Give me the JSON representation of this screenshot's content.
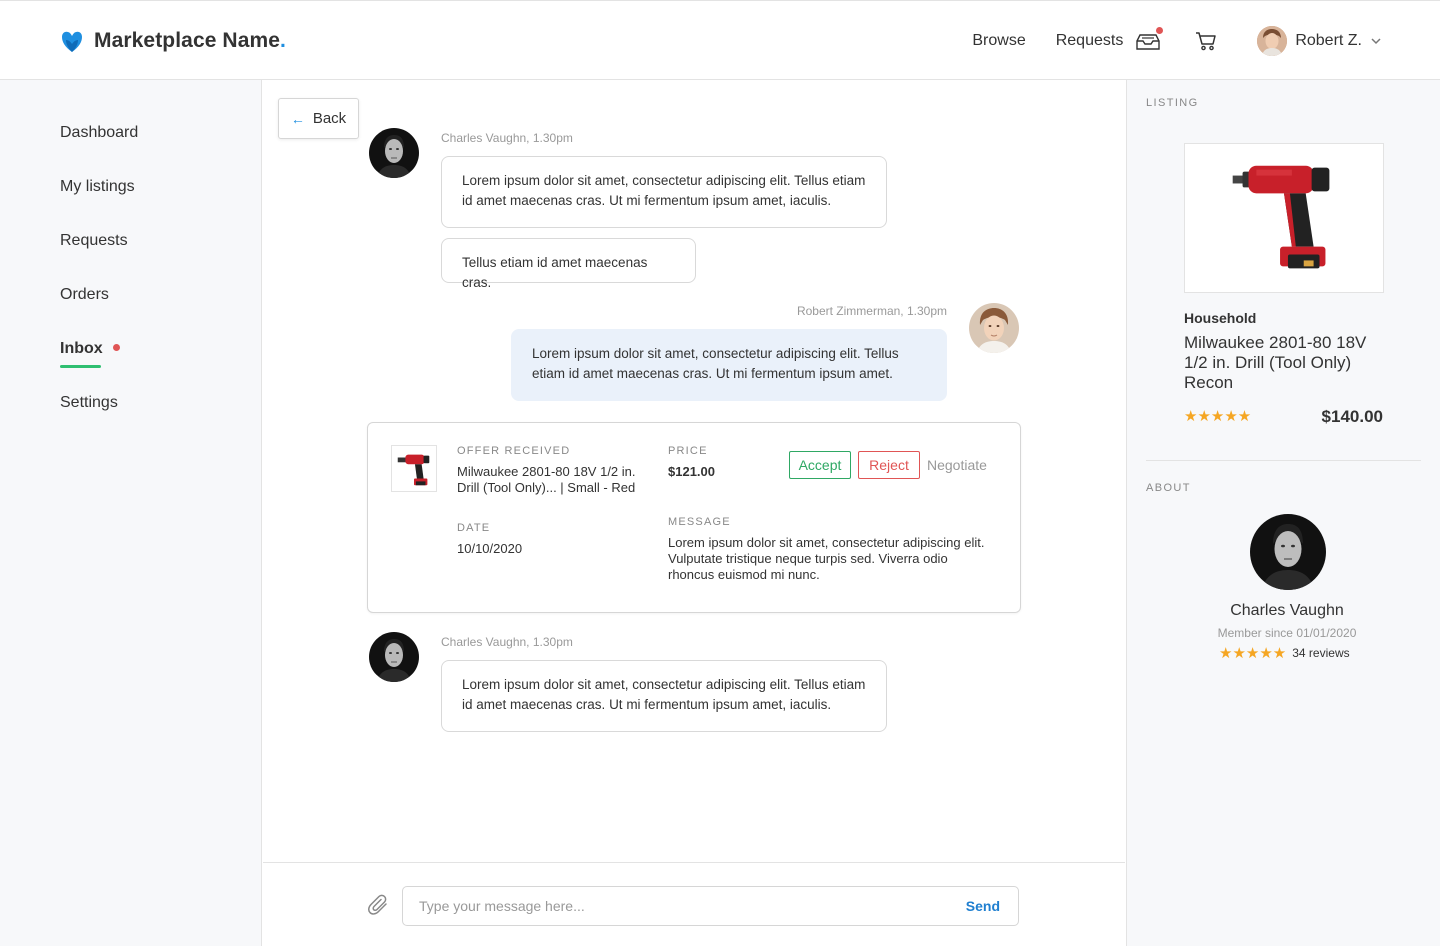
{
  "header": {
    "brand": "Marketplace Name",
    "brand_dot": ".",
    "nav": {
      "browse": "Browse",
      "requests": "Requests"
    },
    "user": {
      "name": "Robert Z."
    },
    "colors": {
      "brand_blue": "#1f8fe0",
      "notification": "#e05555"
    }
  },
  "sidebar": {
    "items": [
      {
        "label": "Dashboard"
      },
      {
        "label": "My listings"
      },
      {
        "label": "Requests"
      },
      {
        "label": "Orders"
      },
      {
        "label": "Inbox",
        "active": true
      },
      {
        "label": "Settings"
      }
    ],
    "active_color": "#2fbf71"
  },
  "chat": {
    "back_label": "Back",
    "messages": [
      {
        "author": "Charles Vaughn",
        "time": "1.30pm",
        "meta": "Charles Vaughn, 1.30pm",
        "bubbles": [
          "Lorem ipsum dolor sit amet, consectetur adipiscing elit. Tellus etiam id amet maecenas cras. Ut mi fermentum ipsum amet, iaculis.",
          "Tellus etiam id amet maecenas cras."
        ]
      },
      {
        "author": "Robert Zimmerman",
        "time": "1.30pm",
        "meta": "Robert Zimmerman, 1.30pm",
        "bubbles": [
          "Lorem ipsum dolor sit amet, consectetur adipiscing elit. Tellus etiam id amet maecenas cras. Ut mi fermentum ipsum amet."
        ]
      },
      {
        "author": "Charles Vaughn",
        "time": "1.30pm",
        "meta": "Charles Vaughn, 1.30pm",
        "bubbles": [
          "Lorem ipsum dolor sit amet, consectetur adipiscing elit. Tellus etiam id amet maecenas cras. Ut mi fermentum ipsum amet, iaculis."
        ]
      }
    ],
    "offer": {
      "label": "OFFER RECEIVED",
      "product": "Milwaukee 2801-80 18V 1/2 in. Drill (Tool Only)...  |  Small - Red",
      "price_label": "PRICE",
      "price": "$121.00",
      "date_label": "DATE",
      "date": "10/10/2020",
      "message_label": "MESSAGE",
      "message": "Lorem ipsum dolor sit amet, consectetur adipiscing elit. Vulputate tristique neque turpis sed. Viverra odio rhoncus euismod mi nunc.",
      "accept": "Accept",
      "reject": "Reject",
      "negotiate": "Negotiate",
      "accept_color": "#2fa864",
      "reject_color": "#e05555"
    },
    "composer": {
      "placeholder": "Type your message here...",
      "send": "Send"
    }
  },
  "listing": {
    "section": "LISTING",
    "category": "Household",
    "title": "Milwaukee 2801-80 18V 1/2 in. Drill (Tool Only) Recon",
    "stars": "★★★★★",
    "rating": 5,
    "price": "$140.00"
  },
  "about": {
    "section": "ABOUT",
    "name": "Charles Vaughn",
    "member_since": "Member since 01/01/2020",
    "stars": "★★★★★",
    "rating": 5,
    "reviews": "34 reviews"
  }
}
